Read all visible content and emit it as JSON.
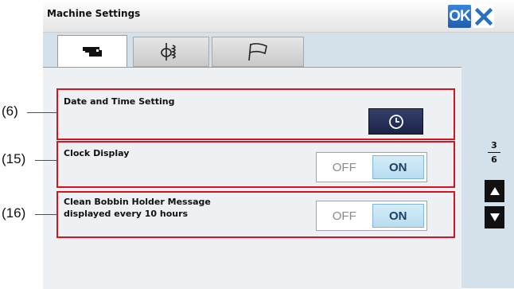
{
  "header": {
    "title": "Machine Settings",
    "ok_label": "OK"
  },
  "tabs": [
    {
      "icon": "sewing-machine-icon",
      "selected": true
    },
    {
      "icon": "stitch-bobbin-icon",
      "selected": false
    },
    {
      "icon": "flag-icon",
      "selected": false
    }
  ],
  "settings": [
    {
      "callout": "(6)",
      "label": "Date and Time Setting",
      "control": "clock-icon-button"
    },
    {
      "callout": "(15)",
      "label": "Clock Display",
      "off_label": "OFF",
      "on_label": "ON",
      "value": "ON"
    },
    {
      "callout": "(16)",
      "label": "Clean Bobbin Holder Message\ndisplayed every 10 hours",
      "off_label": "OFF",
      "on_label": "ON",
      "value": "ON"
    }
  ],
  "pager": {
    "current": "3",
    "total": "6"
  },
  "colors": {
    "callout_border": "#d9131d",
    "ok_button": "#2a72c4",
    "clock_button": "#2a3358",
    "on_selected": "#c7e4f3"
  }
}
